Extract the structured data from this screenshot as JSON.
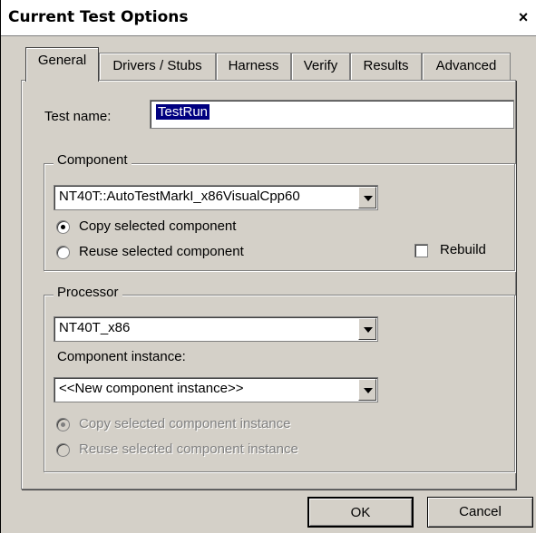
{
  "window": {
    "title": "Current Test Options",
    "close_glyph": "×",
    "close_icon": "close-icon"
  },
  "tabs": [
    {
      "label": "General",
      "active": true
    },
    {
      "label": "Drivers / Stubs",
      "active": false
    },
    {
      "label": "Harness",
      "active": false
    },
    {
      "label": "Verify",
      "active": false
    },
    {
      "label": "Results",
      "active": false
    },
    {
      "label": "Advanced",
      "active": false
    }
  ],
  "general": {
    "test_name_label": "Test name:",
    "test_name_value": "TestRun",
    "component": {
      "legend": "Component",
      "selected": "NT40T::AutoTestMarkI_x86VisualCpp60",
      "copy_label": "Copy selected component",
      "reuse_label": "Reuse selected component",
      "rebuild_label": "Rebuild",
      "copy_checked": true,
      "rebuild_checked": false
    },
    "processor": {
      "legend": "Processor",
      "selected": "NT40T_x86",
      "instance_label": "Component instance:",
      "instance_selected": "<<New component instance>>",
      "copy_instance_label": "Copy selected component instance",
      "reuse_instance_label": "Reuse selected component instance"
    }
  },
  "buttons": {
    "ok": "OK",
    "cancel": "Cancel"
  },
  "colors": {
    "face": "#d4d0c8",
    "selection": "#000080",
    "disabled": "#808080"
  }
}
